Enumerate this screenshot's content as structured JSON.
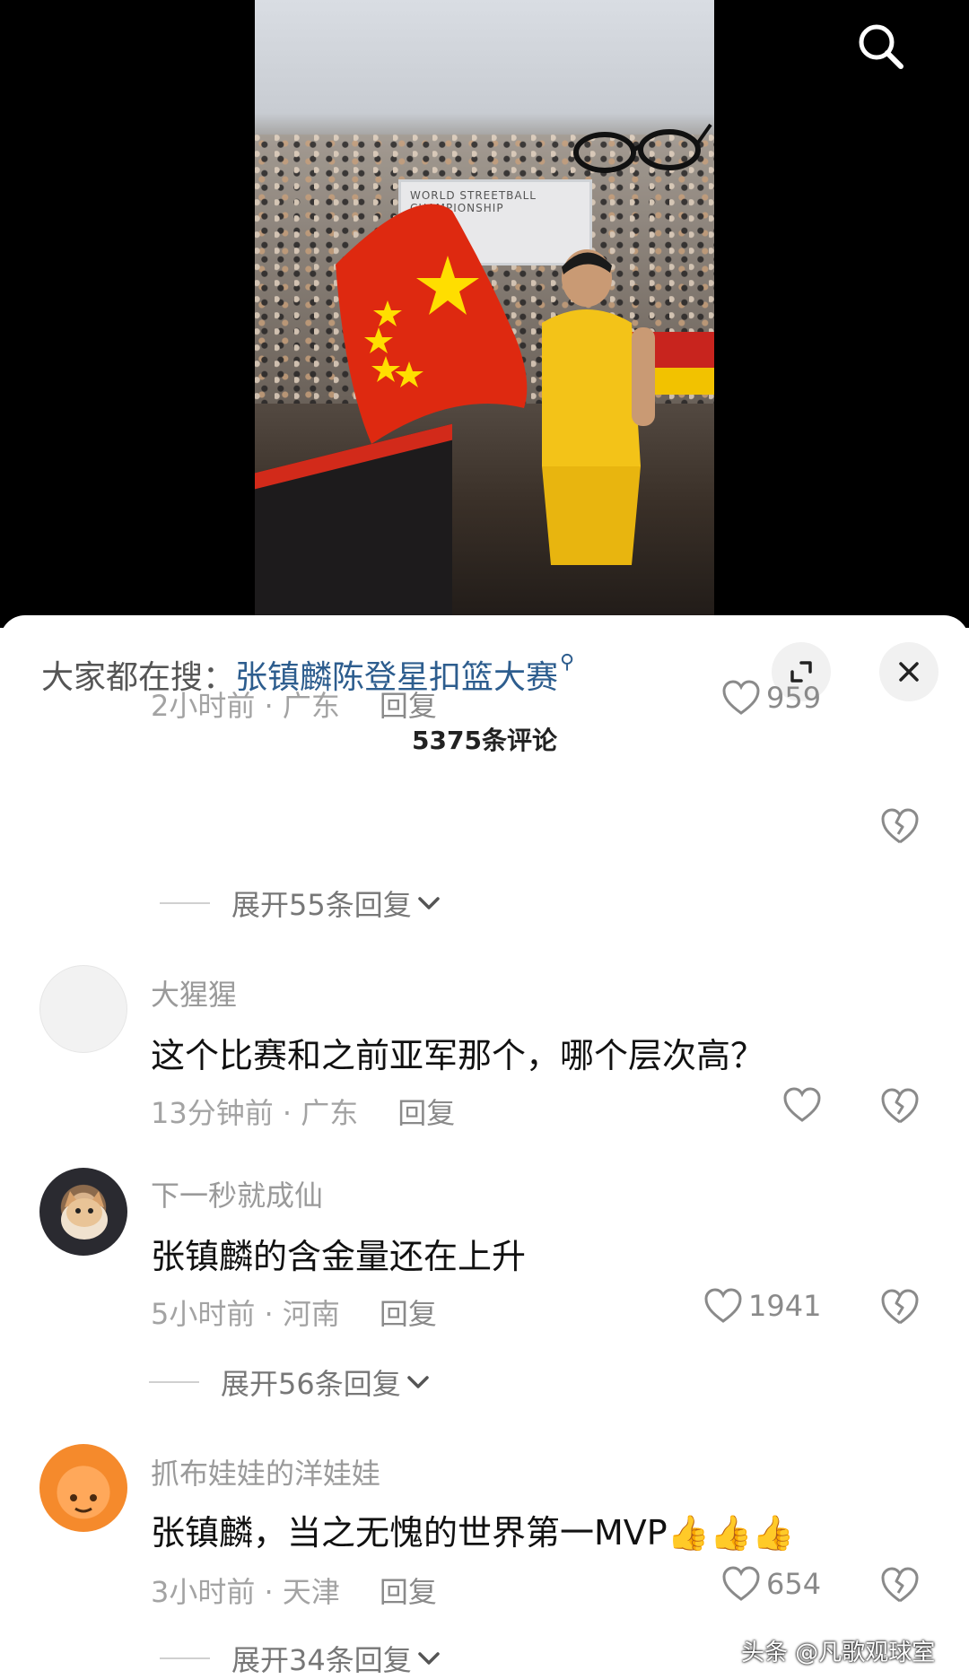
{
  "video": {
    "board_text": "WORLD STREETBALL CHAMPIONSHIP"
  },
  "header": {
    "hot_search_prefix": "大家都在搜：",
    "hot_search_link": "张镇麟陈登星扣篮大赛",
    "comment_count": "5375条评论"
  },
  "comments": [
    {
      "meta_time_location": "2小时前 · 广东",
      "reply_label": "回复",
      "likes": "959",
      "expand_label": "展开55条回复"
    },
    {
      "name": "大猩猩",
      "text": "这个比赛和之前亚军那个，哪个层次高？",
      "meta_time_location": "13分钟前 · 广东",
      "reply_label": "回复",
      "likes": ""
    },
    {
      "name": "下一秒就成仙",
      "text": "张镇麟的含金量还在上升",
      "meta_time_location": "5小时前 · 河南",
      "reply_label": "回复",
      "likes": "1941",
      "expand_label": "展开56条回复"
    },
    {
      "name": "抓布娃娃的洋娃娃",
      "text": "张镇麟，当之无愧的世界第一MVP👍👍👍",
      "meta_time_location": "3小时前 · 天津",
      "reply_label": "回复",
      "likes": "654",
      "expand_label": "展开34条回复"
    }
  ],
  "watermark": "头条 @凡歌观球室",
  "icons": {
    "search": "search-icon",
    "expand": "expand-icon",
    "close": "close-icon",
    "like": "heart-icon",
    "dislike": "broken-heart-icon",
    "chevron": "chevron-down-icon"
  },
  "colors": {
    "link": "#2d5d8e",
    "meta": "#a3a3a3",
    "flag_red": "#de2910",
    "flag_yellow": "#ffde00"
  }
}
